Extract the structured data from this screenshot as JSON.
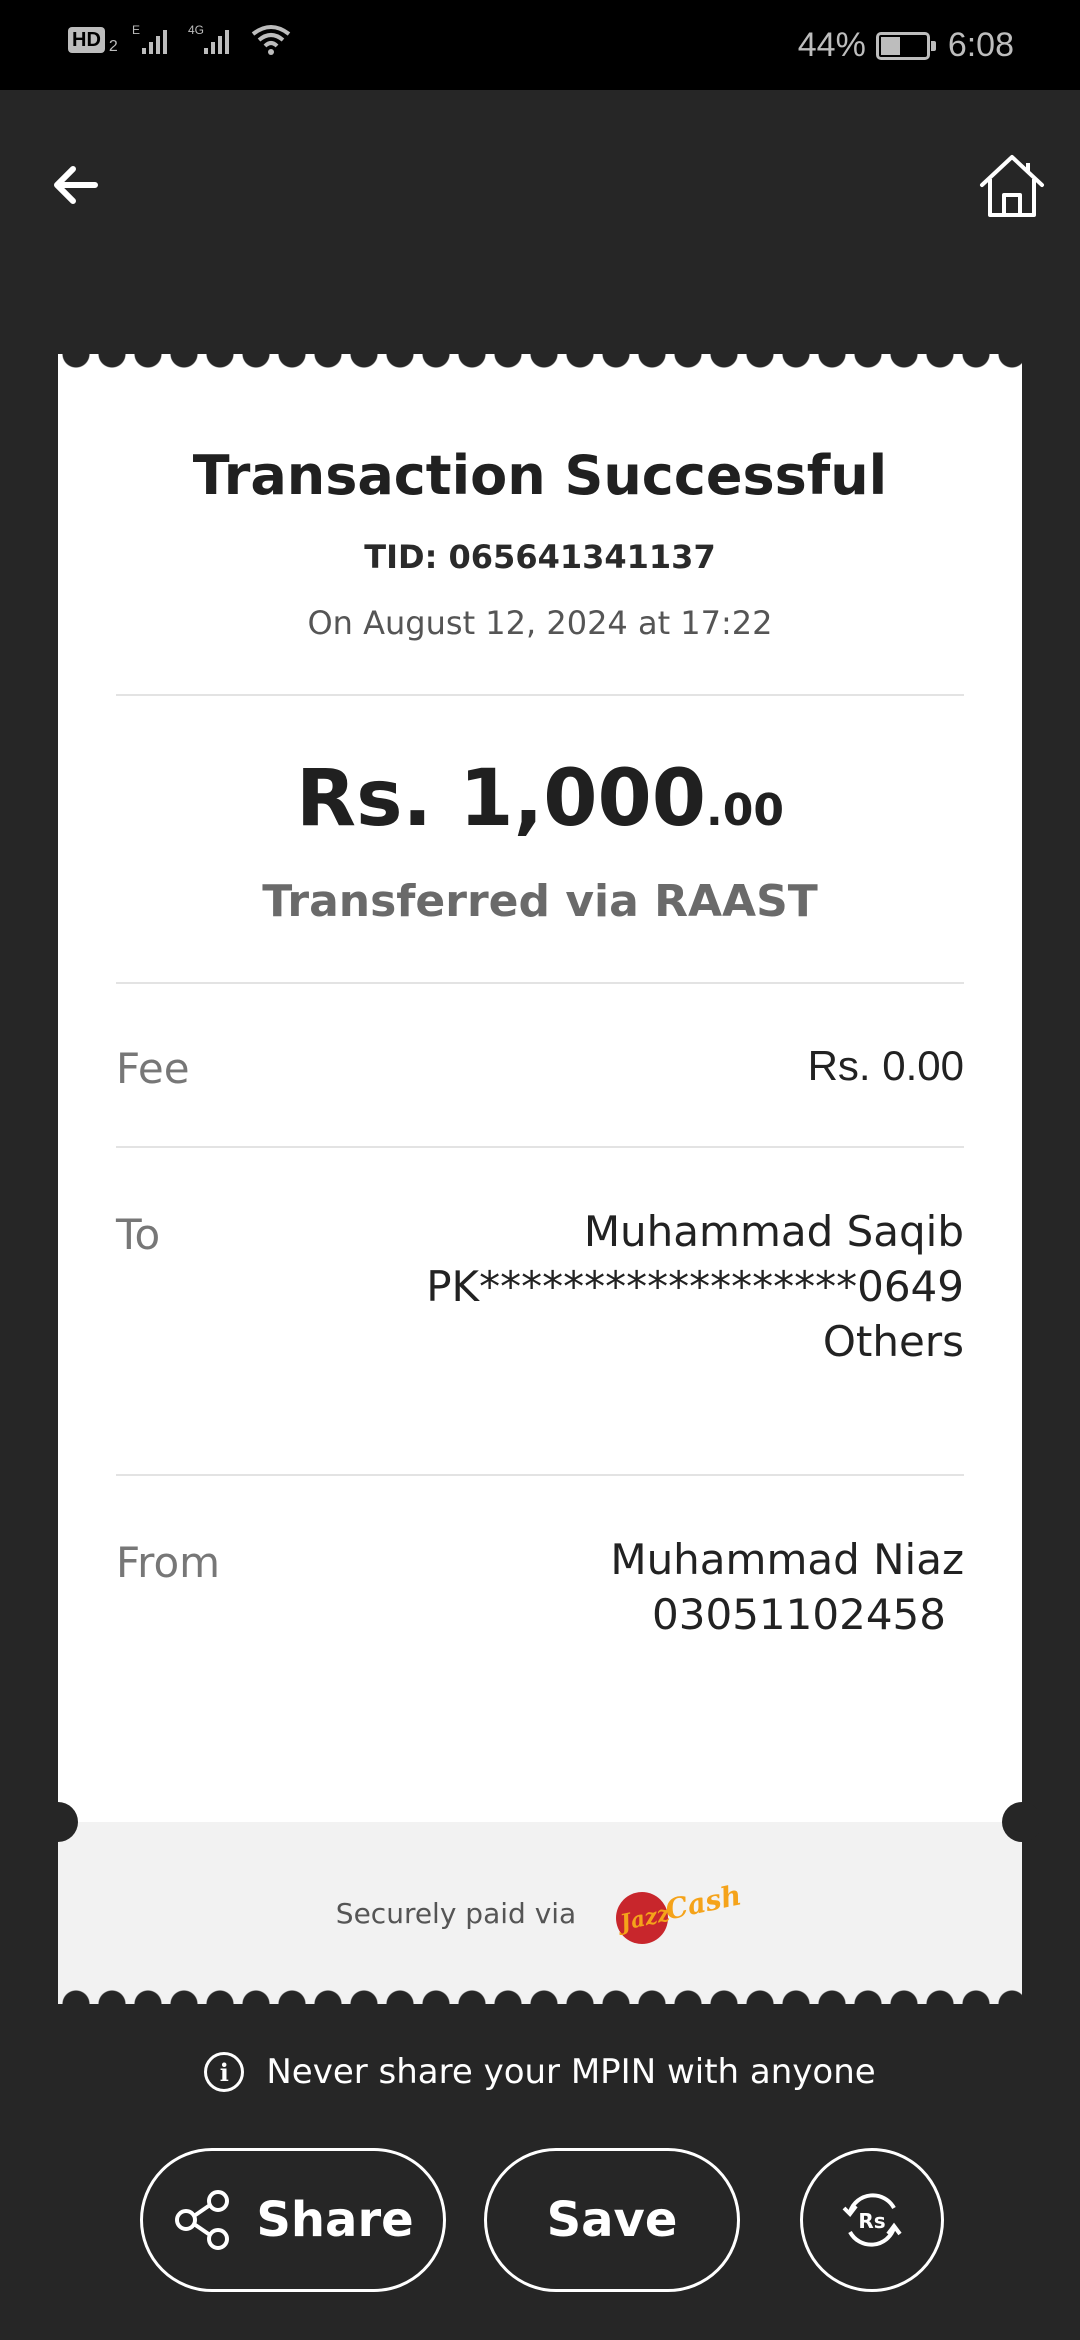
{
  "status_bar": {
    "hd_label": "HD",
    "sim_number": "2",
    "network_1": "E",
    "network_2": "4G",
    "battery_percent": "44%",
    "battery_level": 0.44,
    "time": "6:08"
  },
  "nav": {
    "back_icon": "arrow-left-icon",
    "home_icon": "home-icon"
  },
  "receipt": {
    "title": "Transaction Successful",
    "tid": "TID: 065641341137",
    "datetime": "On August 12, 2024 at 17:22",
    "amount_main": "Rs. 1,000",
    "amount_decimal": ".00",
    "via": "Transferred via RAAST",
    "fee": {
      "label": "Fee",
      "value": "Rs. 0.00"
    },
    "to": {
      "label": "To",
      "name": "Muhammad Saqib",
      "account": "PK******************0649",
      "bank": "Others"
    },
    "from": {
      "label": "From",
      "name": "Muhammad Niaz",
      "number": "03051102458"
    },
    "secure_text": "Securely paid via",
    "logo_text": "JazzCash"
  },
  "notice": "Never share your MPIN with anyone",
  "actions": {
    "share_label": "Share",
    "save_label": "Save",
    "convert_icon_text": "Rs"
  },
  "colors": {
    "background": "#262626",
    "card": "#ffffff",
    "footer": "#f2f2f2",
    "jazz_red": "#c8262c",
    "jazz_yellow": "#f5a31a"
  }
}
